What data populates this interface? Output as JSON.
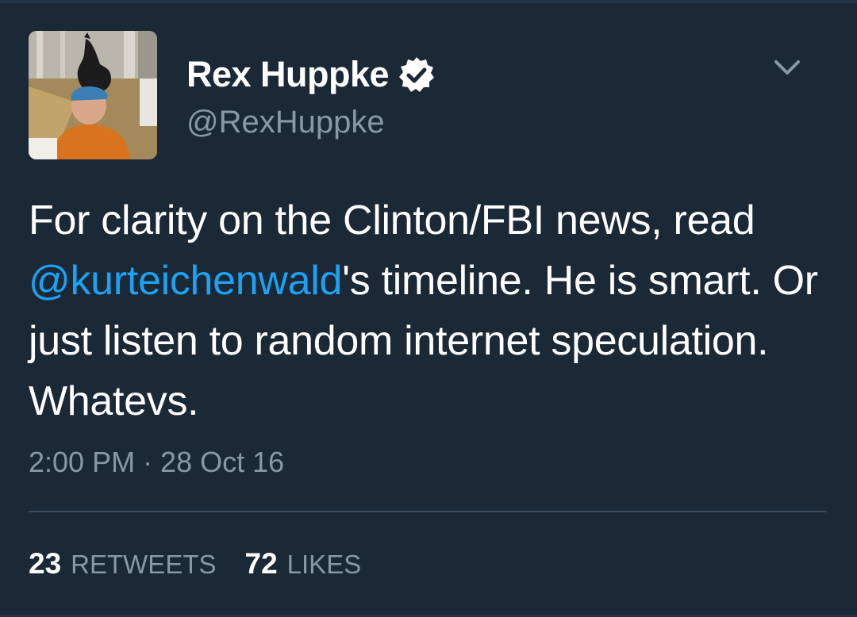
{
  "tweet": {
    "author": {
      "display_name": "Rex Huppke",
      "handle": "@RexHuppke",
      "verified": true
    },
    "text_parts": {
      "part1": "For clarity on the Clinton/FBI news, read ",
      "mention": "@kurteichenwald",
      "part2": "'s timeline. He is smart. Or just listen to random internet speculation. Whatevs."
    },
    "timestamp": "2:00 PM · 28 Oct 16",
    "stats": {
      "retweets_count": "23",
      "retweets_label": "RETWEETS",
      "likes_count": "72",
      "likes_label": "LIKES"
    }
  },
  "icons": {
    "verified": "verified-badge-icon",
    "menu": "chevron-down-icon"
  },
  "colors": {
    "background": "#1b2836",
    "mention": "#1da1f2",
    "secondary_text": "#8899a6",
    "primary_text": "#ffffff"
  }
}
